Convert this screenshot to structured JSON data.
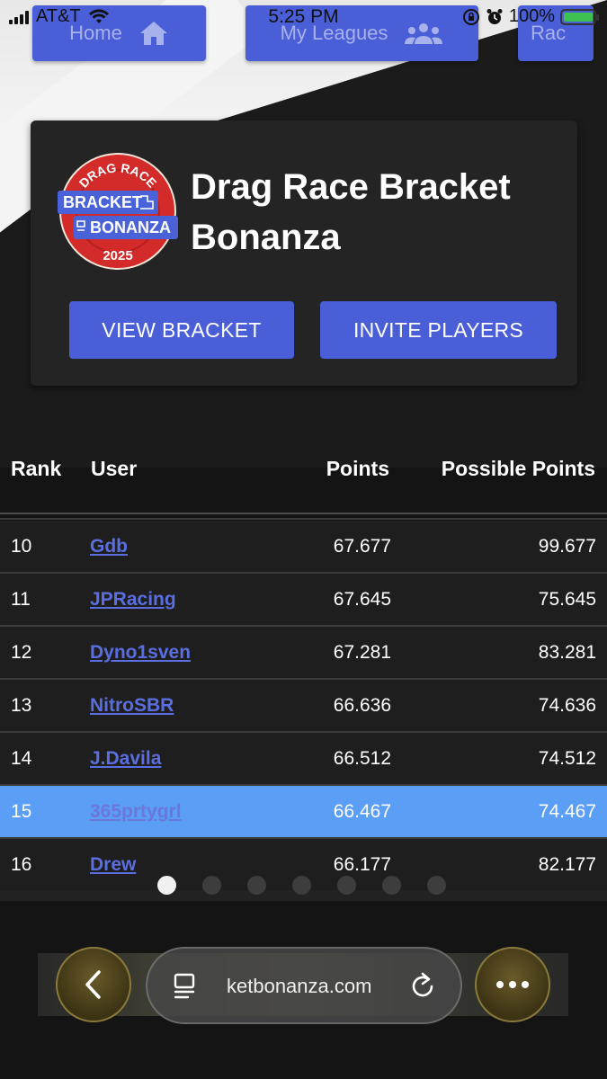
{
  "status_bar": {
    "carrier": "AT&T",
    "time": "5:25 PM",
    "battery": "100%"
  },
  "nav": [
    {
      "label": "Home",
      "icon": "home-icon"
    },
    {
      "label": "My Leagues",
      "icon": "group-icon"
    },
    {
      "label": "Rac",
      "icon": ""
    }
  ],
  "header": {
    "logo_text": {
      "top": "DRAG RACE",
      "line1": "BRACKET",
      "line2": "BONANZA",
      "year": "2025"
    },
    "title": "Drag Race Bracket Bonanza",
    "view_bracket": "VIEW BRACKET",
    "invite_players": "INVITE PLAYERS"
  },
  "table": {
    "headers": {
      "rank": "Rank",
      "user": "User",
      "points": "Points",
      "possible": "Possible Points"
    },
    "rows": [
      {
        "rank": "10",
        "user": "Gdb",
        "points": "67.677",
        "possible": "99.677"
      },
      {
        "rank": "11",
        "user": "JPRacing",
        "points": "67.645",
        "possible": "75.645"
      },
      {
        "rank": "12",
        "user": "Dyno1sven",
        "points": "67.281",
        "possible": "83.281"
      },
      {
        "rank": "13",
        "user": "NitroSBR",
        "points": "66.636",
        "possible": "74.636"
      },
      {
        "rank": "14",
        "user": "J.Davila",
        "points": "66.512",
        "possible": "74.512"
      },
      {
        "rank": "15",
        "user": "365prtygrl",
        "points": "66.467",
        "possible": "74.467"
      },
      {
        "rank": "16",
        "user": "Drew",
        "points": "66.177",
        "possible": "82.177"
      }
    ]
  },
  "pagination": {
    "count": 7,
    "active": 1
  },
  "browser": {
    "url": "ketbonanza.com"
  },
  "colors": {
    "accent": "#4a5fd7",
    "highlight_row": "#5a9ef5",
    "link": "#5b6ee0",
    "logo_red": "#d32a2a"
  }
}
